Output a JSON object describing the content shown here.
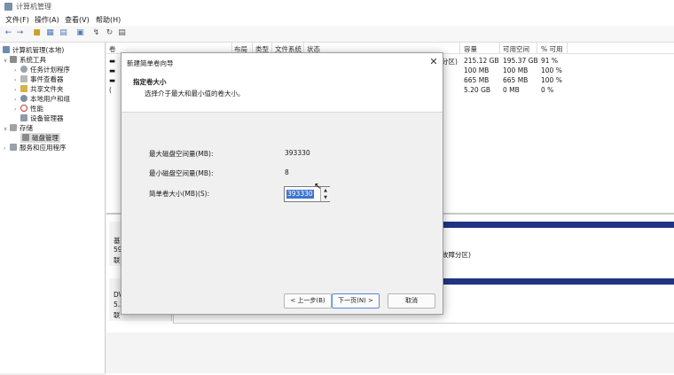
{
  "window": {
    "title": "计算机管理"
  },
  "menu": [
    "文件(F)",
    "操作(A)",
    "查看(V)",
    "帮助(H)"
  ],
  "toolbar": {
    "icons": [
      "back-icon",
      "forward-icon",
      "folder-up-icon",
      "show-hide-tree-icon",
      "properties-icon",
      "help-icon",
      "connect-icon",
      "refresh-icon",
      "export-icon"
    ]
  },
  "tree": {
    "root": "计算机管理(本地)",
    "system_tools": "系统工具",
    "task_scheduler": "任务计划程序",
    "event_viewer": "事件查看器",
    "shared_folders": "共享文件夹",
    "local_users": "本地用户和组",
    "performance": "性能",
    "device_manager": "设备管理器",
    "storage": "存储",
    "disk_management": "磁盘管理",
    "services": "服务和应用程序"
  },
  "columns": [
    "卷",
    "布局",
    "类型",
    "文件系统",
    "状态",
    "容量",
    "可用空间",
    "% 可用"
  ],
  "volumes": [
    {
      "vol": "",
      "status_tail": "分区)",
      "capacity": "215.12 GB",
      "free": "195.37 GB",
      "pct": "91 %"
    },
    {
      "vol": "",
      "status_tail": "",
      "capacity": "100 MB",
      "free": "100 MB",
      "pct": "100 %"
    },
    {
      "vol": "",
      "status_tail": "",
      "capacity": "665 MB",
      "free": "665 MB",
      "pct": "100 %"
    },
    {
      "vol": "(",
      "status_tail": "",
      "capacity": "5.20 GB",
      "free": "0 MB",
      "pct": "0 %"
    }
  ],
  "lower": {
    "disk0_line1": "基",
    "disk0_line2": "59",
    "disk0_line3": "联",
    "disk0_tail": "故障分区)",
    "disk1_line1": "DV",
    "disk1_line2": "5.2",
    "disk1_line3": "联"
  },
  "dialog": {
    "title": "新建简单卷向导",
    "heading": "指定卷大小",
    "subtitle": "选择介于最大和最小值的卷大小。",
    "max_label": "最大磁盘空间量(MB):",
    "max_value": "393330",
    "min_label": "最小磁盘空间量(MB):",
    "min_value": "8",
    "size_label": "简单卷大小(MB)(S):",
    "size_value": "393330",
    "back_button": "< 上一步(B)",
    "next_button": "下一页(N) >",
    "cancel_button": "取消"
  },
  "colors": {
    "accent": "#3d74d0",
    "bar": "#1f3584"
  }
}
